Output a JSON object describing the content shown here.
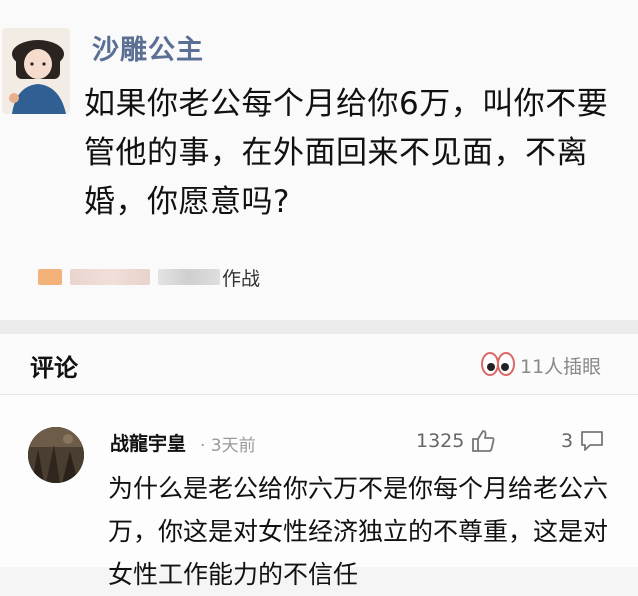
{
  "post": {
    "author": "沙雕公主",
    "text": "如果你老公每个月给你6万，叫你不要管他的事，在外面回来不见面，不离婚，你愿意吗?",
    "source_suffix": "作战"
  },
  "comments": {
    "title": "评论",
    "insert_label": "11人插眼"
  },
  "comment": {
    "author": "战龍宇皇",
    "time": "· 3天前",
    "likes": "1325",
    "replies": "3",
    "text": "为什么是老公给你六万不是你每个月给老公六万，你这是对女性经济独立的不尊重，这是对女性工作能力的不信任"
  }
}
